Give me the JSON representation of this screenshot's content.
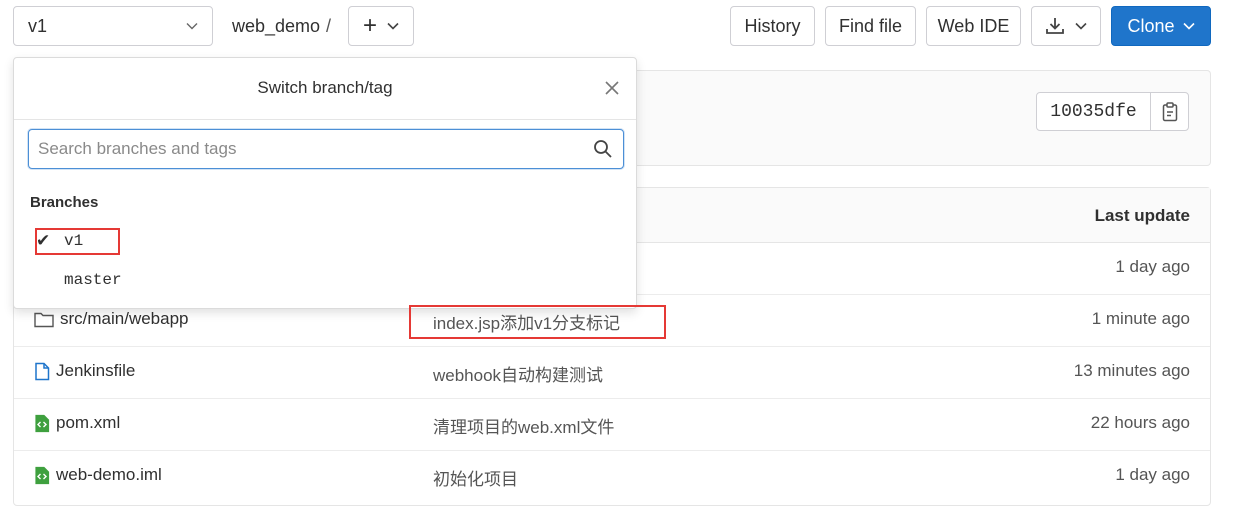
{
  "toolbar": {
    "branch_select": "v1",
    "breadcrumb_project": "web_demo",
    "breadcrumb_sep": "/",
    "add_label": "+",
    "history_label": "History",
    "find_file_label": "Find file",
    "web_ide_label": "Web IDE",
    "clone_label": "Clone"
  },
  "commit": {
    "sha": "10035dfe"
  },
  "dropdown": {
    "title": "Switch branch/tag",
    "search_placeholder": "Search branches and tags",
    "section_label": "Branches",
    "branches": [
      {
        "name": "v1",
        "selected": true,
        "check": "✔"
      },
      {
        "name": "master",
        "selected": false,
        "check": ""
      }
    ]
  },
  "table": {
    "header_last_update": "Last update",
    "rows": [
      {
        "name": "",
        "message": "",
        "time": "1 day ago",
        "icon": "folder-icon"
      },
      {
        "name": "src/main/webapp",
        "message": "index.jsp添加v1分支标记",
        "time": "1 minute ago",
        "icon": "folder-icon"
      },
      {
        "name": "Jenkinsfile",
        "message": "webhook自动构建测试",
        "time": "13 minutes ago",
        "icon": "file-icon"
      },
      {
        "name": "pom.xml",
        "message": "清理项目的web.xml文件",
        "time": "22 hours ago",
        "icon": "file-code-icon"
      },
      {
        "name": "web-demo.iml",
        "message": "初始化项目",
        "time": "1 day ago",
        "icon": "file-code-icon"
      }
    ]
  },
  "colors": {
    "accent": "#1f75cb",
    "highlight": "#e53935"
  }
}
